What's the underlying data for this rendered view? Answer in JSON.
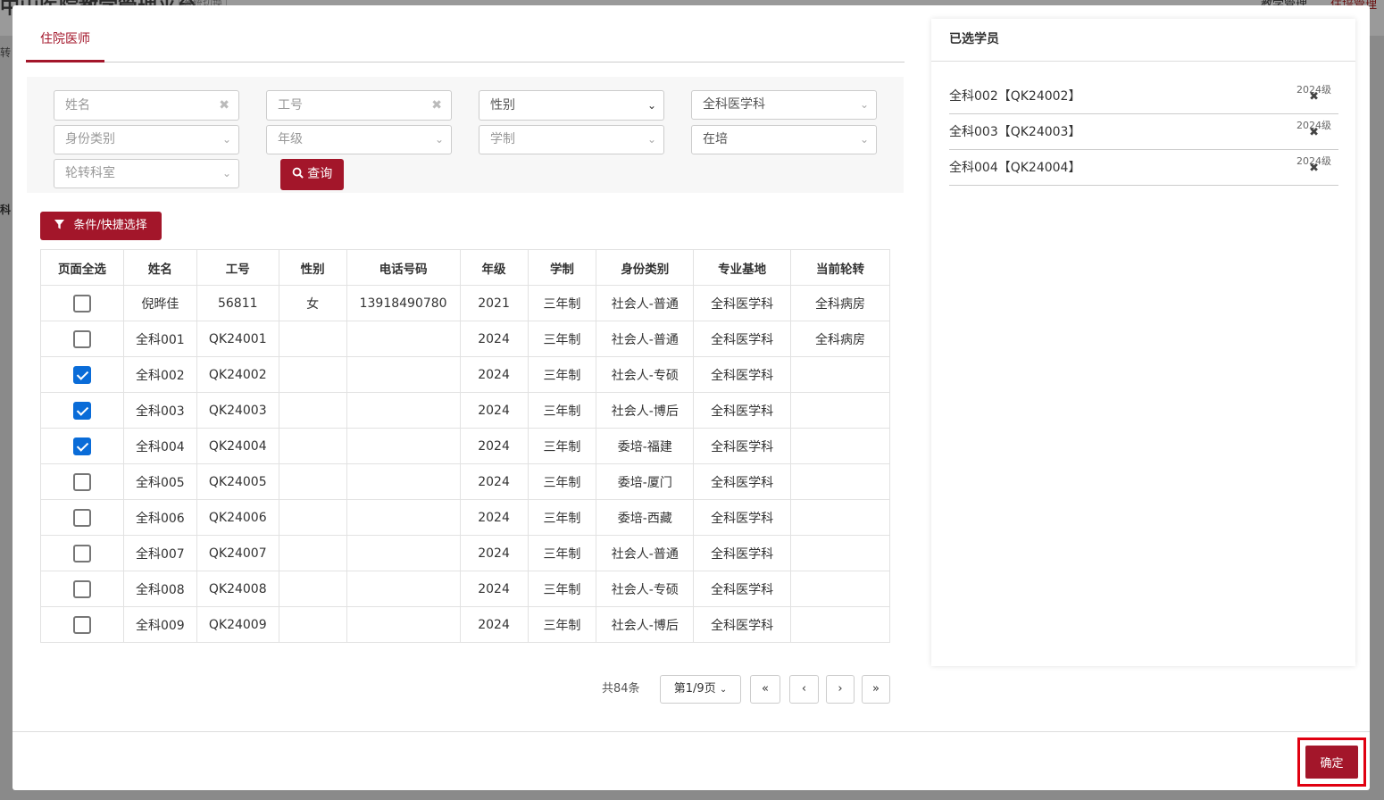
{
  "background": {
    "title": "中山医院教学管理平台",
    "switch_label": "系统切换",
    "right_menu_1": "教学管理",
    "right_menu_2": "住培管理",
    "side_1": "转",
    "side_2": "科"
  },
  "modal": {
    "tab_label": "住院医师",
    "filters": {
      "name_placeholder": "姓名",
      "id_placeholder": "工号",
      "gender_label": "性别",
      "base_value": "全科医学科",
      "identity_placeholder": "身份类别",
      "grade_placeholder": "年级",
      "system_placeholder": "学制",
      "status_value": "在培",
      "dept_placeholder": "轮转科室"
    },
    "query_label": "查询",
    "cond_label": "条件/快捷选择",
    "table": {
      "headers": [
        "页面全选",
        "姓名",
        "工号",
        "性别",
        "电话号码",
        "年级",
        "学制",
        "身份类别",
        "专业基地",
        "当前轮转"
      ],
      "rows": [
        {
          "checked": false,
          "name": "倪晔佳",
          "id": "56811",
          "gender": "女",
          "phone": "13918490780",
          "grade": "2021",
          "system": "三年制",
          "identity": "社会人-普通",
          "base": "全科医学科",
          "rotation": "全科病房"
        },
        {
          "checked": false,
          "name": "全科001",
          "id": "QK24001",
          "gender": "",
          "phone": "",
          "grade": "2024",
          "system": "三年制",
          "identity": "社会人-普通",
          "base": "全科医学科",
          "rotation": "全科病房"
        },
        {
          "checked": true,
          "name": "全科002",
          "id": "QK24002",
          "gender": "",
          "phone": "",
          "grade": "2024",
          "system": "三年制",
          "identity": "社会人-专硕",
          "base": "全科医学科",
          "rotation": ""
        },
        {
          "checked": true,
          "name": "全科003",
          "id": "QK24003",
          "gender": "",
          "phone": "",
          "grade": "2024",
          "system": "三年制",
          "identity": "社会人-博后",
          "base": "全科医学科",
          "rotation": ""
        },
        {
          "checked": true,
          "name": "全科004",
          "id": "QK24004",
          "gender": "",
          "phone": "",
          "grade": "2024",
          "system": "三年制",
          "identity": "委培-福建",
          "base": "全科医学科",
          "rotation": ""
        },
        {
          "checked": false,
          "name": "全科005",
          "id": "QK24005",
          "gender": "",
          "phone": "",
          "grade": "2024",
          "system": "三年制",
          "identity": "委培-厦门",
          "base": "全科医学科",
          "rotation": ""
        },
        {
          "checked": false,
          "name": "全科006",
          "id": "QK24006",
          "gender": "",
          "phone": "",
          "grade": "2024",
          "system": "三年制",
          "identity": "委培-西藏",
          "base": "全科医学科",
          "rotation": ""
        },
        {
          "checked": false,
          "name": "全科007",
          "id": "QK24007",
          "gender": "",
          "phone": "",
          "grade": "2024",
          "system": "三年制",
          "identity": "社会人-普通",
          "base": "全科医学科",
          "rotation": ""
        },
        {
          "checked": false,
          "name": "全科008",
          "id": "QK24008",
          "gender": "",
          "phone": "",
          "grade": "2024",
          "system": "三年制",
          "identity": "社会人-专硕",
          "base": "全科医学科",
          "rotation": ""
        },
        {
          "checked": false,
          "name": "全科009",
          "id": "QK24009",
          "gender": "",
          "phone": "",
          "grade": "2024",
          "system": "三年制",
          "identity": "社会人-博后",
          "base": "全科医学科",
          "rotation": ""
        }
      ]
    },
    "pager": {
      "total": "共84条",
      "page_select": "第1/9页",
      "first": "«",
      "prev": "‹",
      "next": "›",
      "last": "»"
    },
    "selected_panel": {
      "title": "已选学员",
      "items": [
        {
          "name": "全科002【QK24002】",
          "grade": "2024级"
        },
        {
          "name": "全科003【QK24003】",
          "grade": "2024级"
        },
        {
          "name": "全科004【QK24004】",
          "grade": "2024级"
        }
      ]
    },
    "confirm_label": "确定"
  }
}
